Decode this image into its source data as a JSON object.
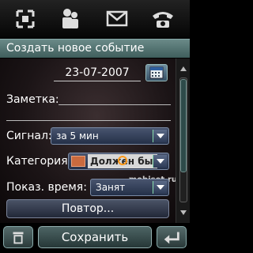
{
  "top_bar": {
    "icons": [
      "scan-icon",
      "contacts-icon",
      "message-icon",
      "phone-icon"
    ]
  },
  "title": "Создать новое событие",
  "form": {
    "date_value": "23-07-2007",
    "note_label": "Заметка:",
    "signal_label": "Сигнал:",
    "signal_value": "за 5 мин",
    "category_label": "Категория:",
    "category_value": "Должен быть",
    "category_color": "#c96a3e",
    "show_time_label": "Показ. время:",
    "show_time_value": "Занят",
    "repeat_button": "Повтор..."
  },
  "watermark": "mobiset.ru",
  "bottom_bar": {
    "save_label": "Сохранить"
  }
}
